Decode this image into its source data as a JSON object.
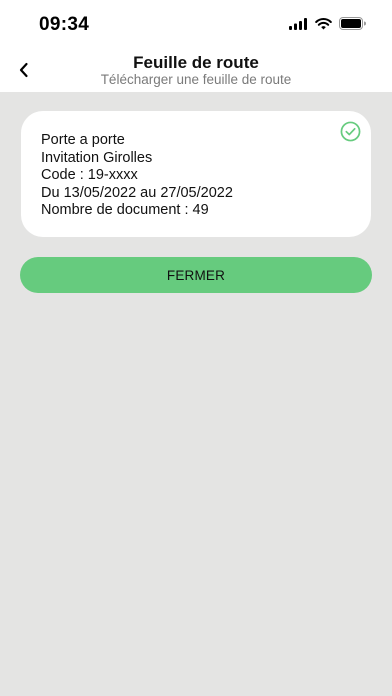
{
  "status_bar": {
    "time": "09:34"
  },
  "header": {
    "title": "Feuille de route",
    "subtitle": "Télécharger une feuille de route"
  },
  "card": {
    "lines": [
      "Porte a porte",
      "Invitation Girolles",
      "Code : 19-xxxx",
      "Du 13/05/2022 au 27/05/2022",
      "Nombre de document : 49"
    ],
    "status_icon": "check-circle-icon"
  },
  "actions": {
    "close_label": "FERMER"
  },
  "colors": {
    "accent": "#66cb7e",
    "background": "#e4e4e3"
  }
}
